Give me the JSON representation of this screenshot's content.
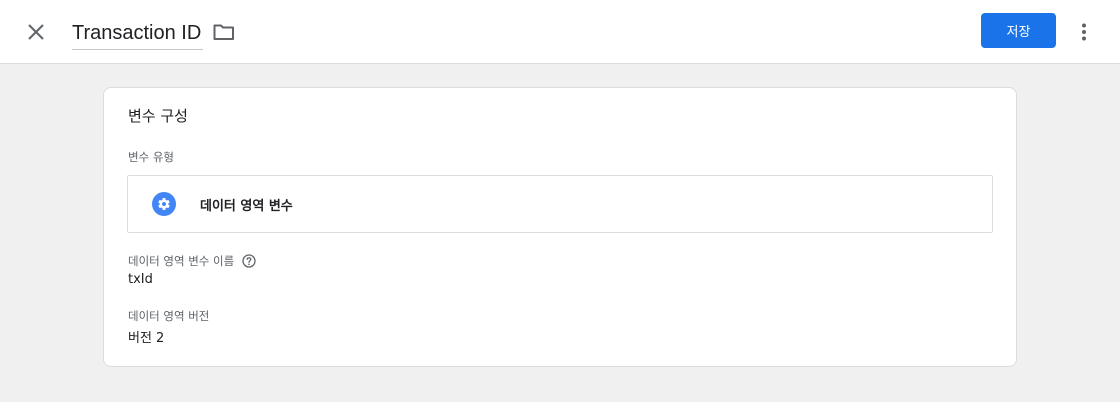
{
  "header": {
    "title": "Transaction ID",
    "save_label": "저장"
  },
  "icons": {
    "close": "close-icon",
    "folder": "folder-icon",
    "more": "more-vert-icon",
    "settings": "gear-icon",
    "help": "help-icon"
  },
  "colors": {
    "accent": "#1a73e8",
    "type_icon": "#4285f4",
    "page_bg": "#f0f0f0"
  },
  "card": {
    "title": "변수 구성",
    "variable_type_label": "변수 유형",
    "variable_type_value": "데이터 영역 변수",
    "name_label": "데이터 영역 변수 이름",
    "name_value": "txId",
    "version_label": "데이터 영역 버전",
    "version_value": "버전 2"
  }
}
